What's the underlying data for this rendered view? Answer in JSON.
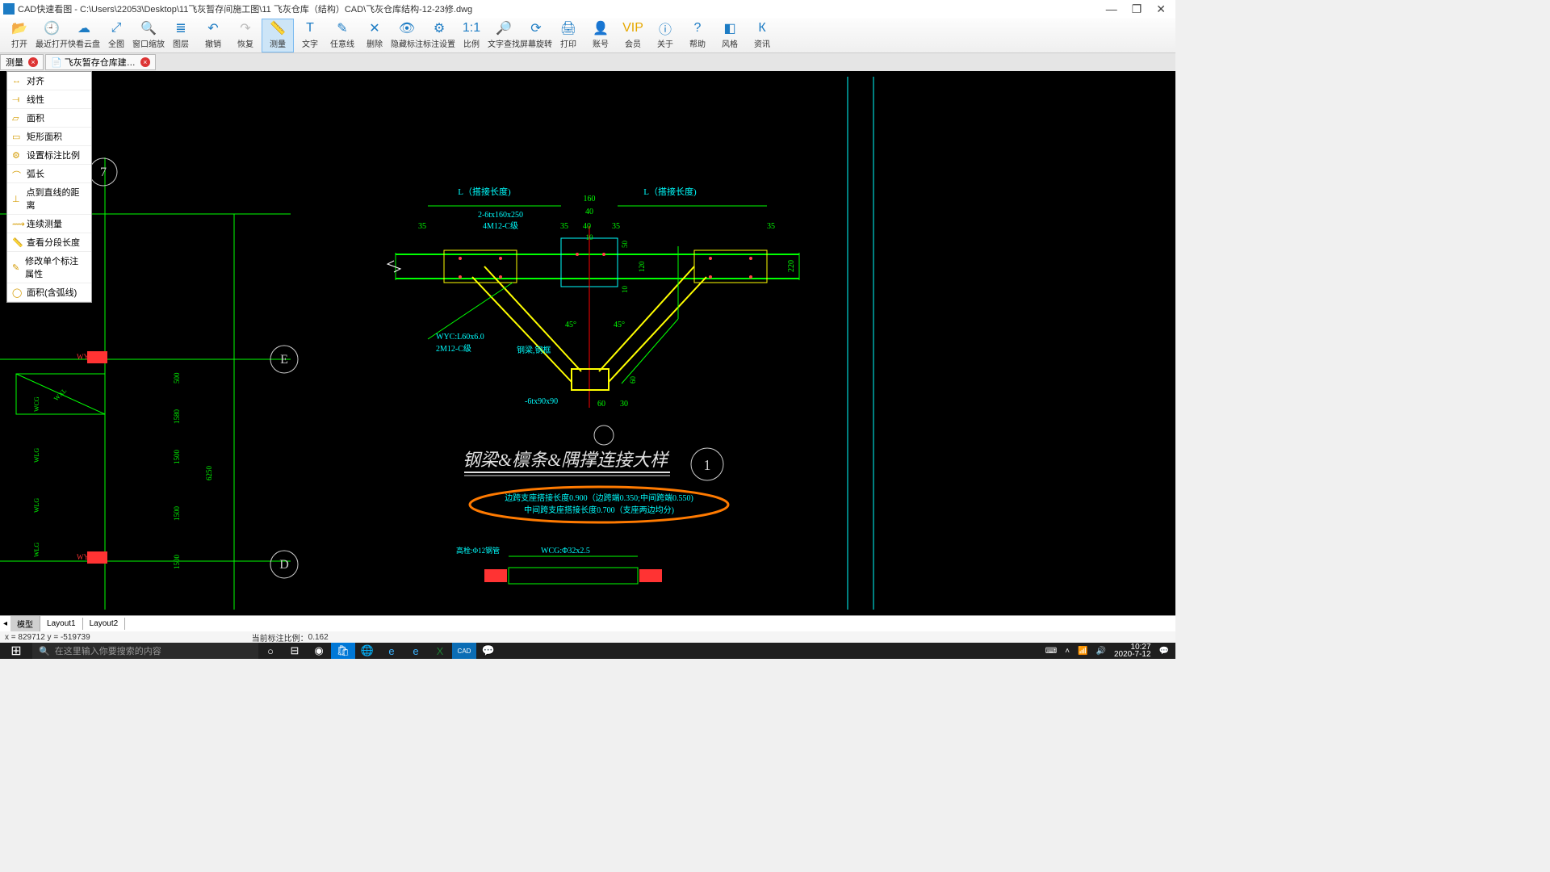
{
  "window": {
    "title": "CAD快速看图 - C:\\Users\\22053\\Desktop\\11飞灰暂存间施工图\\11 飞灰仓库（结构）CAD\\飞灰仓库结构-12-23修.dwg"
  },
  "toolbar": [
    {
      "id": "open",
      "label": "打开",
      "color": "#1d7cc4",
      "glyph": "📂"
    },
    {
      "id": "recent",
      "label": "最近打开",
      "color": "#1d7cc4",
      "glyph": "🕘"
    },
    {
      "id": "cloud",
      "label": "快看云盘",
      "color": "#1d7cc4",
      "glyph": "☁"
    },
    {
      "id": "full",
      "label": "全图",
      "color": "#1d7cc4",
      "glyph": "⤢"
    },
    {
      "id": "zoomwin",
      "label": "窗口缩放",
      "color": "#1d7cc4",
      "glyph": "🔍"
    },
    {
      "id": "layers",
      "label": "图层",
      "color": "#1d7cc4",
      "glyph": "≣"
    },
    {
      "id": "undo",
      "label": "撤销",
      "color": "#1d7cc4",
      "glyph": "↶"
    },
    {
      "id": "redo",
      "label": "恢复",
      "color": "#bbbbbb",
      "glyph": "↷"
    },
    {
      "id": "measure",
      "label": "测量",
      "color": "#1d7cc4",
      "glyph": "📏",
      "active": true
    },
    {
      "id": "text",
      "label": "文字",
      "color": "#1d7cc4",
      "glyph": "T"
    },
    {
      "id": "freeline",
      "label": "任意线",
      "color": "#1d7cc4",
      "glyph": "✎"
    },
    {
      "id": "delete",
      "label": "删除",
      "color": "#1d7cc4",
      "glyph": "✕"
    },
    {
      "id": "hideanno",
      "label": "隐藏标注",
      "color": "#1d7cc4",
      "glyph": "👁"
    },
    {
      "id": "annoset",
      "label": "标注设置",
      "color": "#1d7cc4",
      "glyph": "⚙"
    },
    {
      "id": "scale",
      "label": "比例",
      "color": "#1d7cc4",
      "glyph": "1:1"
    },
    {
      "id": "textsearch",
      "label": "文字查找",
      "color": "#1d7cc4",
      "glyph": "🔎"
    },
    {
      "id": "rotate",
      "label": "屏幕旋转",
      "color": "#1d7cc4",
      "glyph": "⟳"
    },
    {
      "id": "print",
      "label": "打印",
      "color": "#1d7cc4",
      "glyph": "🖨"
    },
    {
      "id": "account",
      "label": "账号",
      "color": "#1d7cc4",
      "glyph": "👤"
    },
    {
      "id": "vip",
      "label": "会员",
      "color": "#e6a800",
      "glyph": "VIP"
    },
    {
      "id": "about",
      "label": "关于",
      "color": "#1d7cc4",
      "glyph": "ⓘ"
    },
    {
      "id": "help",
      "label": "帮助",
      "color": "#1d7cc4",
      "glyph": "?"
    },
    {
      "id": "style",
      "label": "风格",
      "color": "#1d7cc4",
      "glyph": "◧"
    },
    {
      "id": "news",
      "label": "资讯",
      "color": "#1d7cc4",
      "glyph": "К"
    }
  ],
  "tabs": [
    {
      "name": "测量",
      "closable": true
    },
    {
      "name": "飞灰暂存仓库建…",
      "closable": true
    }
  ],
  "measure_menu": [
    "对齐",
    "线性",
    "面积",
    "矩形面积",
    "设置标注比例",
    "弧长",
    "点到直线的距离",
    "连续测量",
    "查看分段长度",
    "修改单个标注属性",
    "面积(含弧线)"
  ],
  "drawing": {
    "dims_top": {
      "L1": "L（搭接长度)",
      "L2": "L（搭接长度)",
      "d160": "160",
      "d40": "40",
      "spec1": "2-6tx160x250",
      "spec2": "4M12-C级",
      "d35": "35",
      "d10": "10"
    },
    "dims_right": {
      "d50": "50",
      "d120": "120",
      "d10": "10",
      "d220": "220"
    },
    "dims_bottom": {
      "d60": "60",
      "d30": "30",
      "spec3": "-6tx90x90",
      "d60b": "60"
    },
    "labels": {
      "wyc": "WYC:L60x6.0",
      "m12": "2M12-C级",
      "gl": "钢梁,钢框",
      "a45": "45°"
    },
    "title": {
      "main": "钢梁&檩条&隅撑连接大样",
      "num": "1"
    },
    "notes": {
      "n1": "边跨支座搭接长度0.900（边跨端0.350;中间跨端0.550)",
      "n2": "中间跨支座搭接长度0.700（支座两边均分)"
    },
    "lower": {
      "wcg": "WCG:Φ32x2.5",
      "bolt": "高栓:Φ12钢管"
    },
    "left_grid": {
      "g7": "7",
      "gE": "E",
      "gD": "D",
      "v500": "500",
      "v1580": "1580",
      "v1500": "1500",
      "v6250": "6250",
      "wyc": "WYC",
      "wlg": "WLG",
      "wcg": "WCG",
      "wxl": "WXL"
    }
  },
  "layout_tabs": [
    "模型",
    "Layout1",
    "Layout2"
  ],
  "status": {
    "coords": "x = 829712  y = -519739",
    "scale_label": "当前标注比例：",
    "scale_val": "0.162"
  },
  "taskbar": {
    "search_placeholder": "在这里输入你要搜索的内容",
    "time": "10:27",
    "date": "2020-7-12"
  }
}
